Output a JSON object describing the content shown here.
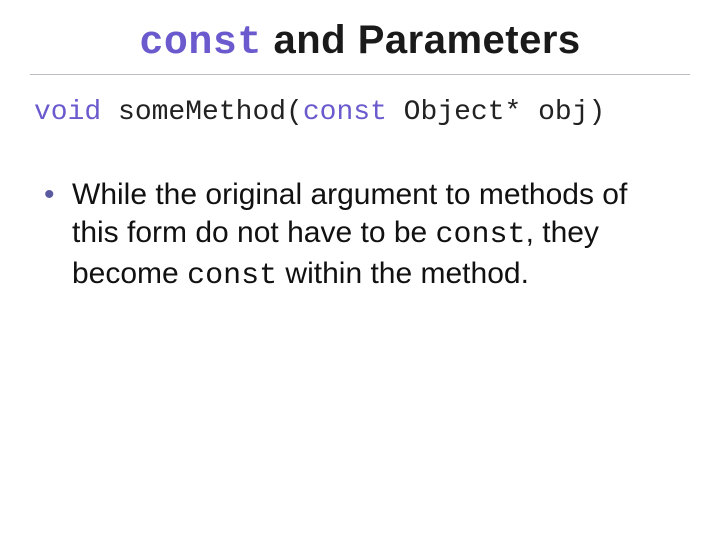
{
  "title": {
    "keyword": "const",
    "rest": " and Parameters"
  },
  "code": {
    "void": "void",
    "fn_open": " someMethod(",
    "const": "const",
    "rest": " Object* obj)"
  },
  "bullet": {
    "t1": "While the original argument to methods of this form do not have to be ",
    "const1": "const",
    "t2": ", they become ",
    "const2": "const",
    "t3": " within the method."
  }
}
